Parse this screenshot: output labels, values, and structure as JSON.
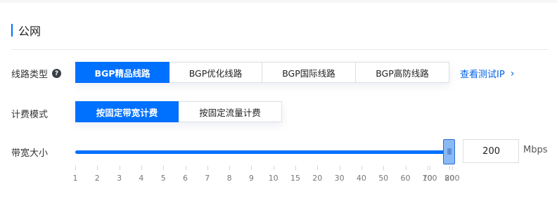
{
  "section": {
    "title": "公网"
  },
  "line_type": {
    "label": "线路类型",
    "options": [
      "BGP精品线路",
      "BGP优化线路",
      "BGP国际线路",
      "BGP高防线路"
    ],
    "selected": 0,
    "link": "查看测试IP"
  },
  "billing": {
    "label": "计费模式",
    "options": [
      "按固定带宽计费",
      "按固定流量计费"
    ],
    "selected": 0
  },
  "bandwidth": {
    "label": "带宽大小",
    "value": "200",
    "unit": "Mbps",
    "level": 1.0,
    "ticks": [
      "1",
      "2",
      "3",
      "4",
      "5",
      "6",
      "7",
      "8",
      "9",
      "10",
      "15",
      "20",
      "30",
      "40",
      "50",
      "60",
      "70",
      "80",
      "100",
      "200"
    ]
  },
  "colors": {
    "accent": "#0070ff",
    "link": "#0062e6"
  },
  "icons": {
    "help": "question-circle-icon",
    "link_arrow": "chevron-right-icon",
    "handle": "grip-icon"
  }
}
